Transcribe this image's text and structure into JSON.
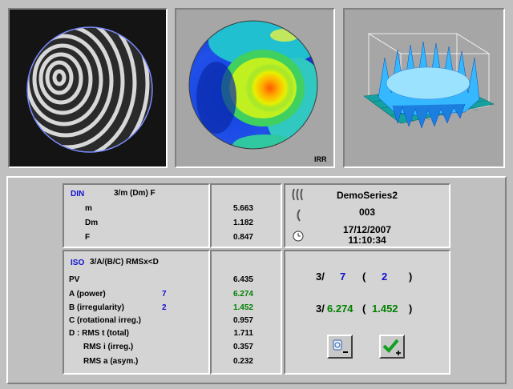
{
  "images": {
    "overlay_label": "IRR"
  },
  "din": {
    "title": "DIN",
    "formula": "3/m (Dm) F",
    "rows": [
      {
        "label": "m",
        "value": "5.663"
      },
      {
        "label": "Dm",
        "value": "1.182"
      },
      {
        "label": "F",
        "value": "0.847"
      }
    ]
  },
  "info": {
    "series": "DemoSeries2",
    "number": "003",
    "date": "17/12/2007",
    "time": "11:10:34"
  },
  "iso": {
    "title": "ISO",
    "formula": "3/A/(B/C) RMSx<D",
    "rows": [
      {
        "label": "PV",
        "mid": "",
        "value": "6.435"
      },
      {
        "label": "A  (power)",
        "mid": "7",
        "value": "6.274"
      },
      {
        "label": "B  (irregularity)",
        "mid": "2",
        "value": "1.452"
      },
      {
        "label": "C  (rotational irreg.)",
        "mid": "",
        "value": "0.957"
      },
      {
        "label": "D : RMS t  (total)",
        "mid": "",
        "value": "1.711"
      },
      {
        "label": "RMS i  (irreg.)",
        "mid": "",
        "value": "0.357"
      },
      {
        "label": "RMS a  (asym.)",
        "mid": "",
        "value": "0.232"
      }
    ]
  },
  "result": {
    "prefix1": "3/",
    "target_a": "7",
    "open1": "(",
    "target_b": "2",
    "close1": ")",
    "prefix2": "3/",
    "measured_a": "6.274",
    "open2": "(",
    "measured_b": "1.452",
    "close2": ")"
  },
  "colors": {
    "accent_blue": "#1010d0",
    "accent_green": "#008000",
    "background": "#c0c0c0"
  },
  "buttons": {
    "reject_icon": "camera-minus-icon",
    "accept_icon": "check-plus-icon"
  }
}
